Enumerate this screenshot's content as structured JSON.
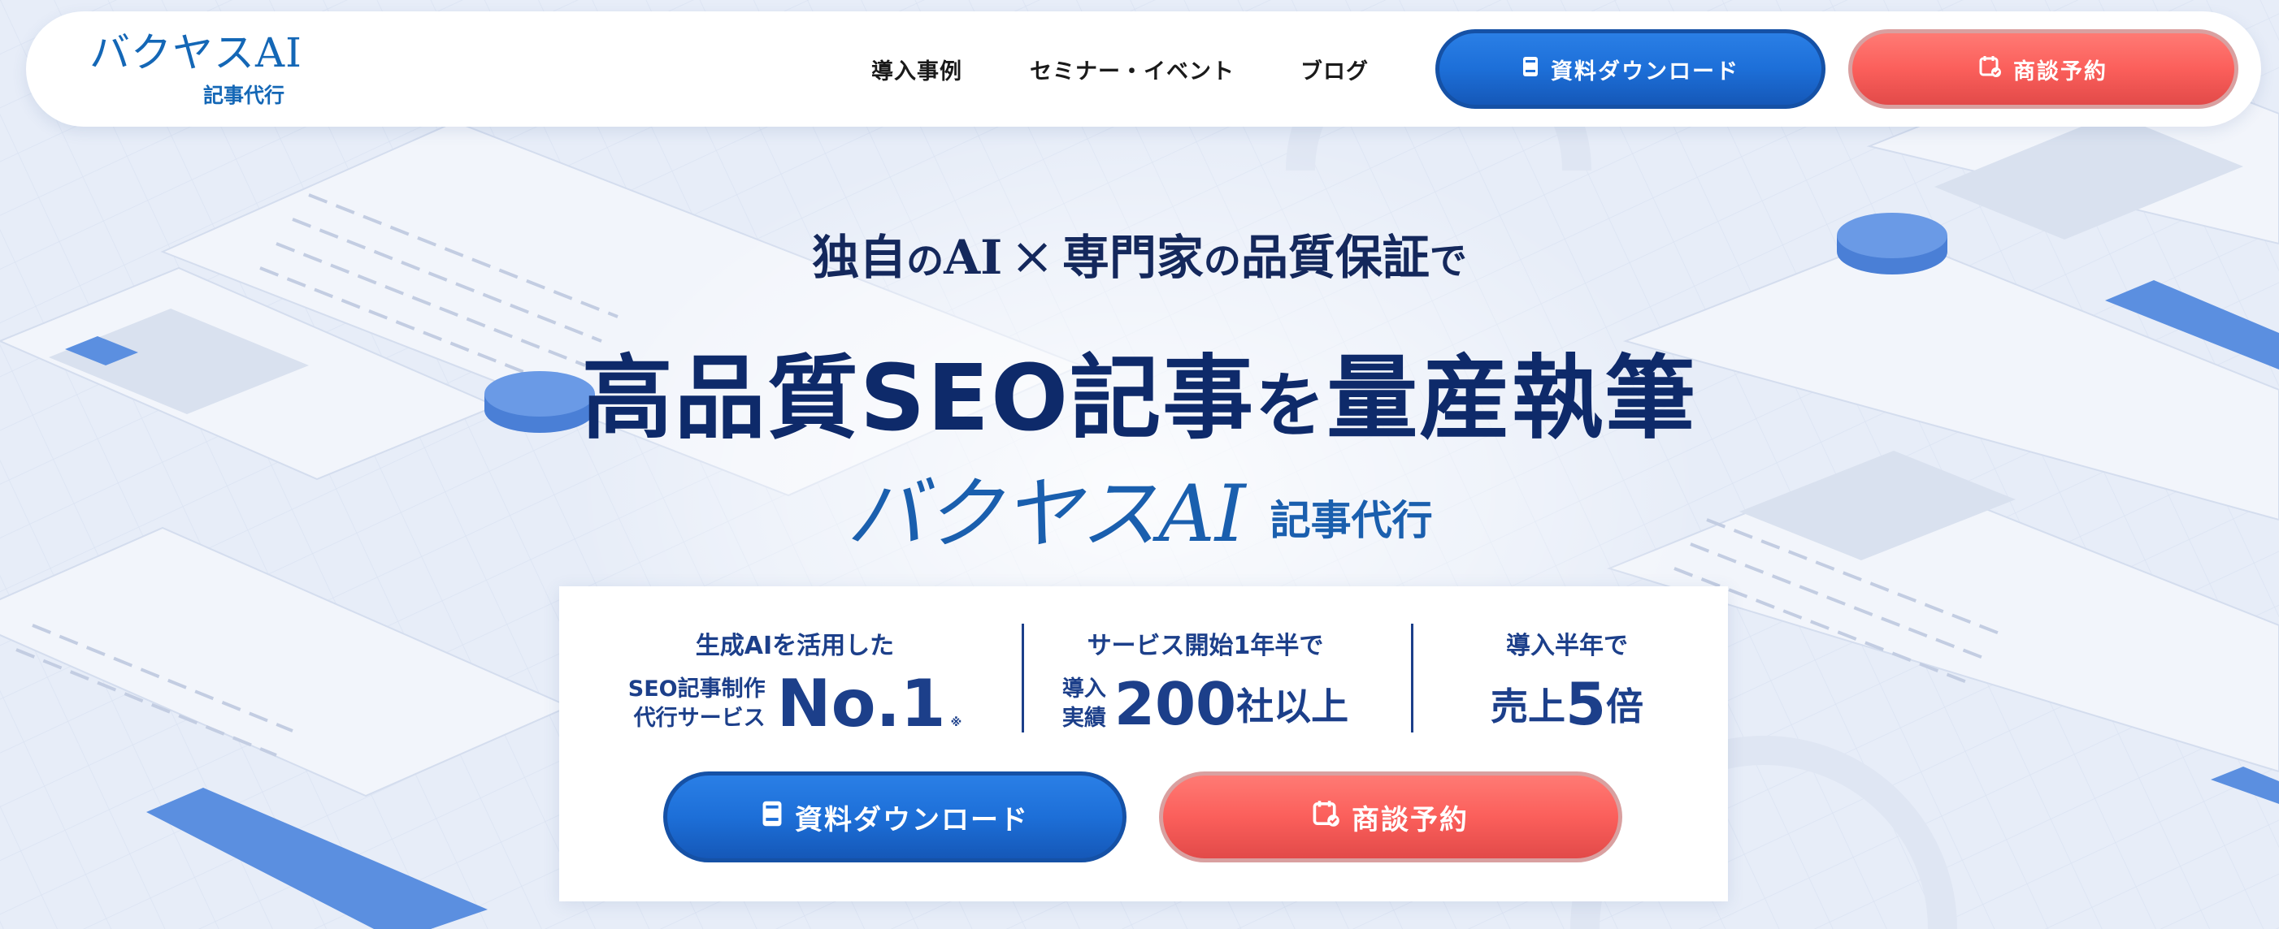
{
  "header": {
    "logo": {
      "main": "バクヤスAI",
      "sub": "記事代行"
    },
    "nav": [
      {
        "label": "導入事例"
      },
      {
        "label": "セミナー・イベント"
      },
      {
        "label": "ブログ"
      }
    ],
    "download_button": {
      "label": "資料ダウンロード",
      "icon": "document-icon"
    },
    "meeting_button": {
      "label": "商談予約",
      "icon": "calendar-check-icon"
    }
  },
  "hero": {
    "tagline": {
      "part1": "独自",
      "part2": "の",
      "part3": "AI",
      "cross": "×",
      "part4": "専門家",
      "part5": "の",
      "part6": "品質保証",
      "part7": "で"
    },
    "headline": {
      "part1": "高品質SEO記事",
      "part2": "を",
      "part3": "量産執筆"
    },
    "brand": {
      "main": "バクヤスAI",
      "sub": "記事代行"
    }
  },
  "stats": {
    "stat1": {
      "top": "生成AIを活用した",
      "left_line1": "SEO記事制作",
      "left_line2": "代行サービス",
      "big": "No.1",
      "note": "※"
    },
    "stat2": {
      "top": "サービス開始1年半で",
      "left_line1": "導入",
      "left_line2": "実績",
      "big": "200",
      "suffix": "社以上"
    },
    "stat3": {
      "top": "導入半年で",
      "prefix": "売上",
      "big": "5",
      "suffix": "倍"
    }
  },
  "cta": {
    "download_button": {
      "label": "資料ダウンロード",
      "icon": "document-icon"
    },
    "meeting_button": {
      "label": "商談予約",
      "icon": "calendar-check-icon"
    }
  },
  "colors": {
    "primary_blue": "#1d6fd8",
    "accent_red": "#fb5f5b",
    "navy_text": "#0e2a6a",
    "brand_blue": "#1467b6"
  }
}
